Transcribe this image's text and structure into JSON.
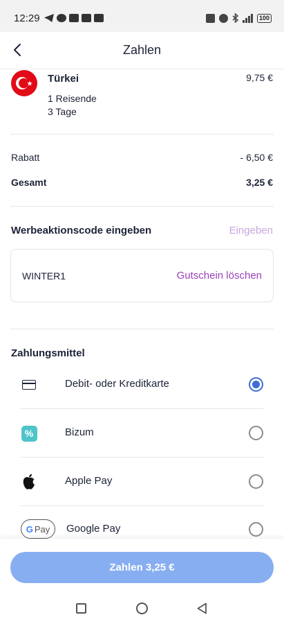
{
  "status_bar": {
    "time": "12:29",
    "left_icons": [
      "telegram-icon",
      "facebook-icon",
      "youtube-icon",
      "youtube-icon",
      "youtube-icon"
    ],
    "right_icons": [
      "nfc-icon",
      "alarm-icon",
      "bluetooth-icon",
      "signal-5g-icon"
    ],
    "battery": "100"
  },
  "header": {
    "title": "Zahlen"
  },
  "order_item": {
    "country": "Türkei",
    "price": "9,75 €",
    "travelers": "1 Reisende",
    "duration": "3 Tage"
  },
  "summary": {
    "discount_label": "Rabatt",
    "discount_value": "- 6,50 €",
    "total_label": "Gesamt",
    "total_value": "3,25 €"
  },
  "promo": {
    "title": "Werbeaktionscode eingeben",
    "enter_link": "Eingeben",
    "code": "WINTER1",
    "delete_link": "Gutschein löschen"
  },
  "payment": {
    "title": "Zahlungsmittel",
    "methods": [
      {
        "label": "Debit- oder Kreditkarte",
        "icon": "credit-card-icon",
        "selected": true
      },
      {
        "label": "Bizum",
        "icon": "bizum-icon",
        "selected": false
      },
      {
        "label": "Apple Pay",
        "icon": "apple-icon",
        "selected": false
      },
      {
        "label": "Google Pay",
        "icon": "google-pay-icon",
        "selected": false
      }
    ],
    "gpay_badge_text": "Pay"
  },
  "cta": {
    "label": "Zahlen 3,25 €"
  },
  "colors": {
    "accent_blue": "#3d6cdb",
    "button_blue": "#88aef2",
    "promo_purple": "#9b42bb",
    "promo_light_purple": "#c9a6df",
    "flag_red": "#e30a17",
    "bizum_teal": "#4fc4c9"
  }
}
